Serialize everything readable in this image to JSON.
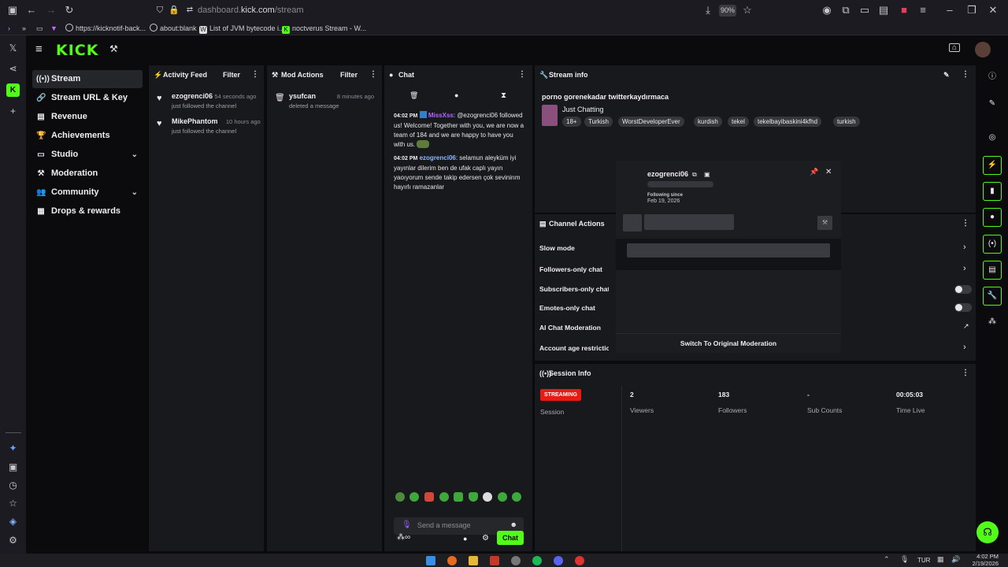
{
  "browser": {
    "url_prefix": "dashboard.",
    "url_domain": "kick.com",
    "url_path": "/stream",
    "zoom": "90%",
    "bookmarks": [
      "https://kicknotif-back...",
      "about:blank",
      "List of JVM bytecode i...",
      "noctverus Stream - W..."
    ]
  },
  "app": {
    "logo": "KICK"
  },
  "nav": {
    "items": [
      {
        "label": "Stream",
        "icon": "((•))"
      },
      {
        "label": "Stream URL & Key",
        "icon": "🔗"
      },
      {
        "label": "Revenue",
        "icon": "▤"
      },
      {
        "label": "Achievements",
        "icon": "🏆"
      },
      {
        "label": "Studio",
        "icon": "▭"
      },
      {
        "label": "Moderation",
        "icon": "⚒"
      },
      {
        "label": "Community",
        "icon": "👥"
      },
      {
        "label": "Drops & rewards",
        "icon": "▦"
      }
    ]
  },
  "activity": {
    "title": "Activity Feed",
    "filter": "Filter",
    "items": [
      {
        "name": "ezogrenci06",
        "time": "54 seconds ago",
        "sub": "just followed the channel"
      },
      {
        "name": "MikePhantom",
        "time": "10 hours ago",
        "sub": "just followed the channel"
      }
    ]
  },
  "mod": {
    "title": "Mod Actions",
    "filter": "Filter",
    "items": [
      {
        "name": "ysufcan",
        "time": "8 minutes ago",
        "sub": "deleted a message"
      }
    ]
  },
  "chat": {
    "title": "Chat",
    "messages": [
      {
        "time": "04:02 PM",
        "user": "MissXss",
        "text": "@ezogrenci06 followed us! Welcome! Together with you, we are now a team of 184 and we are happy to have you with us."
      },
      {
        "time": "04:02 PM",
        "user": "ezogrenci06",
        "text": "selamun aleyküm iyi yayınlar dilerim ben de ufak caplı yayın yaoıyorum sende takip edersen çok sevinirım hayırlı ramazanlar"
      }
    ],
    "placeholder": "Send a message",
    "send_label": "Chat"
  },
  "stream_info": {
    "header": "Stream info",
    "title": "porno gorenekadar twitterkaydırmaca",
    "category": "Just Chatting",
    "tags": [
      "18+",
      "Turkish",
      "WorstDeveloperEver",
      "kurdish",
      "tekel",
      "tekelbayibaskini4kfhd",
      "turkish"
    ]
  },
  "user_card": {
    "username": "ezogrenci06",
    "following_label": "Following since",
    "following_date": "Feb 19, 2026",
    "switch_label": "Switch To Original Moderation"
  },
  "channel_actions": {
    "title": "Channel Actions",
    "rows": [
      "Slow mode",
      "Followers-only chat",
      "Subscribers-only chat",
      "Emotes-only chat",
      "AI Chat Moderation",
      "Account age restriction"
    ]
  },
  "session": {
    "title": "Session Info",
    "badge": "STREAMING",
    "badge_label": "Session",
    "stats": [
      {
        "value": "2",
        "label": "Viewers"
      },
      {
        "value": "183",
        "label": "Followers"
      },
      {
        "value": "-",
        "label": "Sub Counts"
      },
      {
        "value": "00:05:03",
        "label": "Time Live"
      }
    ]
  },
  "taskbar": {
    "lang": "TUR",
    "time": "4:02 PM",
    "date": "2/19/2026"
  },
  "colors": {
    "accent": "#53fc18",
    "streaming": "#e91916",
    "panel": "#18191d"
  }
}
